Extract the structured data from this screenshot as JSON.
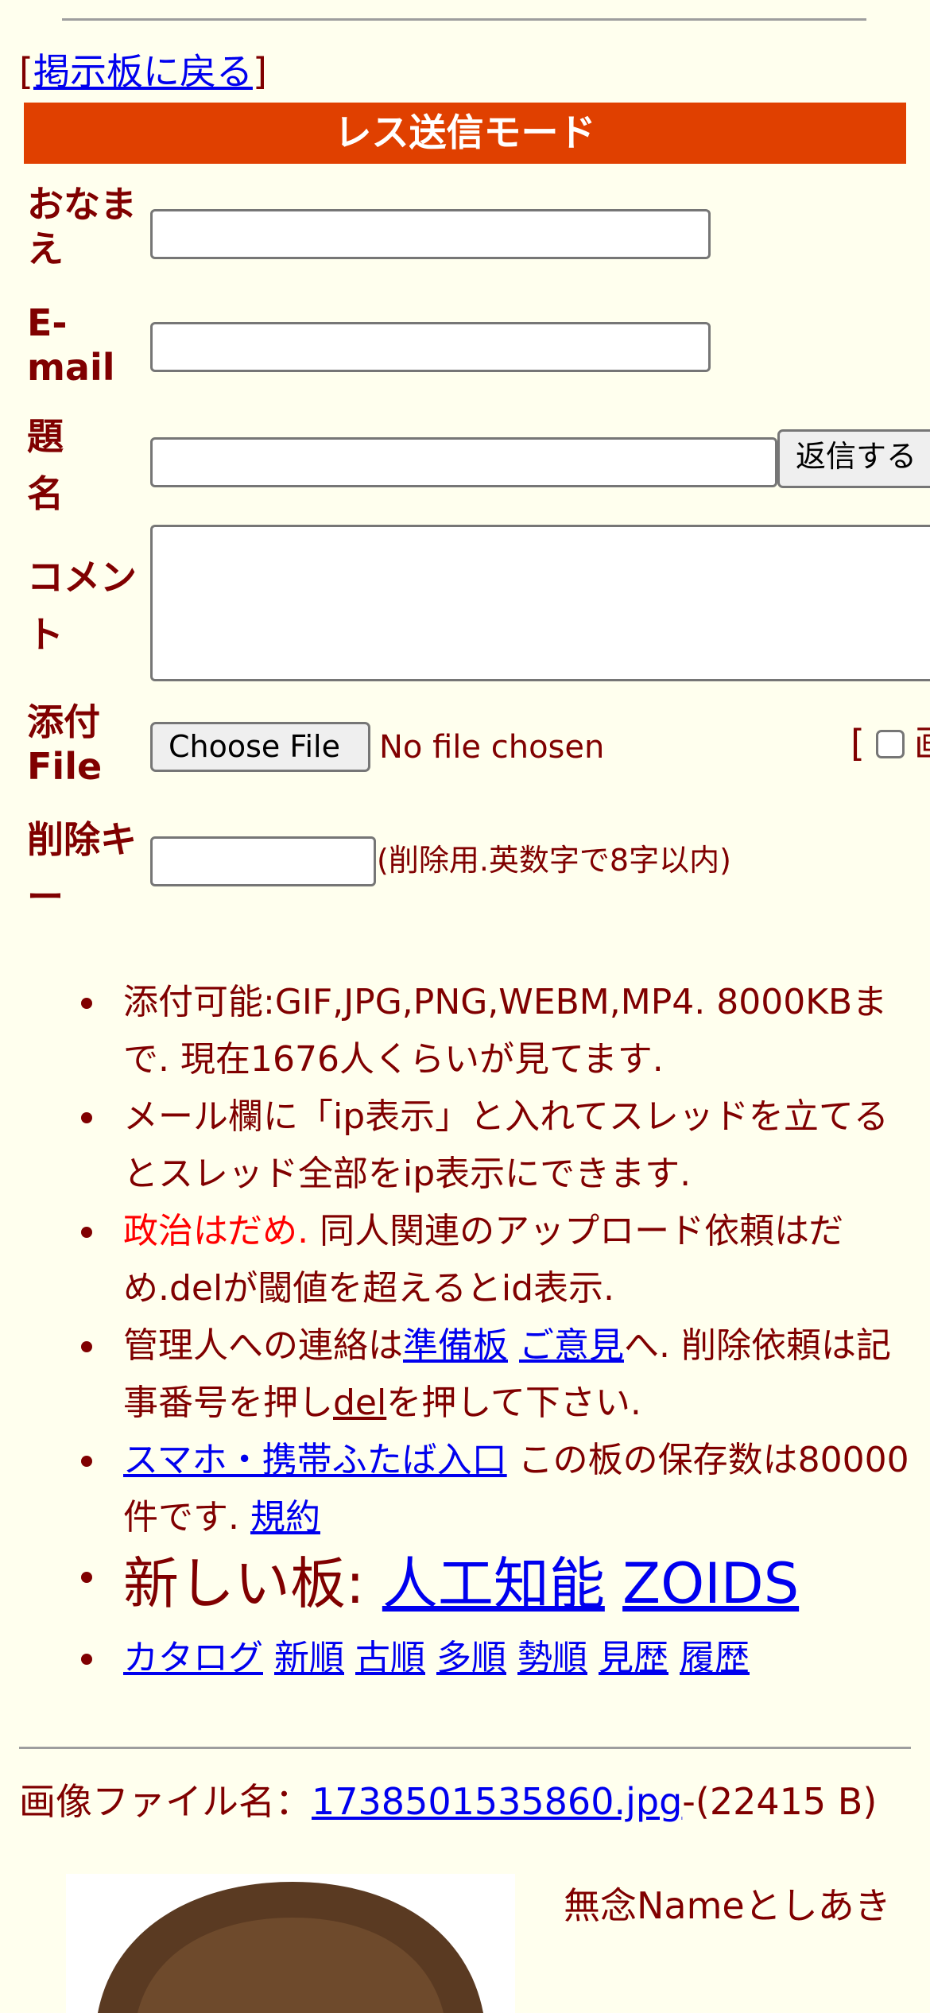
{
  "nav": {
    "back_prefix": "[",
    "back_link": "掲示板に戻る",
    "back_suffix": "]"
  },
  "mode_title": "レス送信モード",
  "form": {
    "name_label": [
      "おなま",
      "え"
    ],
    "email_label": [
      "E-",
      "mail"
    ],
    "subject_label": [
      "題",
      "名"
    ],
    "comment_label": [
      "コメン",
      "ト"
    ],
    "file_label": [
      "添付",
      "File"
    ],
    "delkey_label": [
      "削除キ",
      "ー"
    ],
    "submit_label": "返信する",
    "choose_file_label": "Choose File",
    "no_file_text": "No file chosen",
    "bracket": "[",
    "checkbox_label": "画",
    "delkey_note": "(削除用.英数字で8字以内)"
  },
  "info": {
    "line1": "添付可能:GIF,JPG,PNG,WEBM,MP4. 8000KBまで. 現在1676人くらいが見てます.",
    "line2": "メール欄に「ip表示」と入れてスレッドを立てるとスレッド全部をip表示にできます.",
    "line3_red": "政治はだめ.",
    "line3_rest": " 同人関連のアップロード依頼はだめ.delが閾値を超えるとid表示.",
    "line4_a": "管理人への連絡は",
    "line4_link1": "準備板",
    "line4_link2": "ご意見",
    "line4_b": "へ. 削除依頼は記事番号を押し",
    "line4_link3": "del",
    "line4_c": "を押して下さい.",
    "line5_link": "スマホ・携帯ふたば入口",
    "line5_a": " この板の保存数は80000件です. ",
    "line5_link2": "規約",
    "new_boards_label": "新しい板: ",
    "new_board_1": "人工知能",
    "new_board_2": "ZOIDS",
    "sort_links": [
      "カタログ",
      "新順",
      "古順",
      "多順",
      "勢順",
      "見歴",
      "履歴"
    ]
  },
  "post": {
    "file_prefix": "画像ファイル名：",
    "file_name": "1738501535860.jpg",
    "file_size": "-(22415 B)",
    "name": "無念Nameとしあき"
  },
  "colors": {
    "background": "#ffffee",
    "text": "#800000",
    "mode_bar": "#e04000",
    "link": "#0000ee",
    "warning": "#ff0000"
  }
}
